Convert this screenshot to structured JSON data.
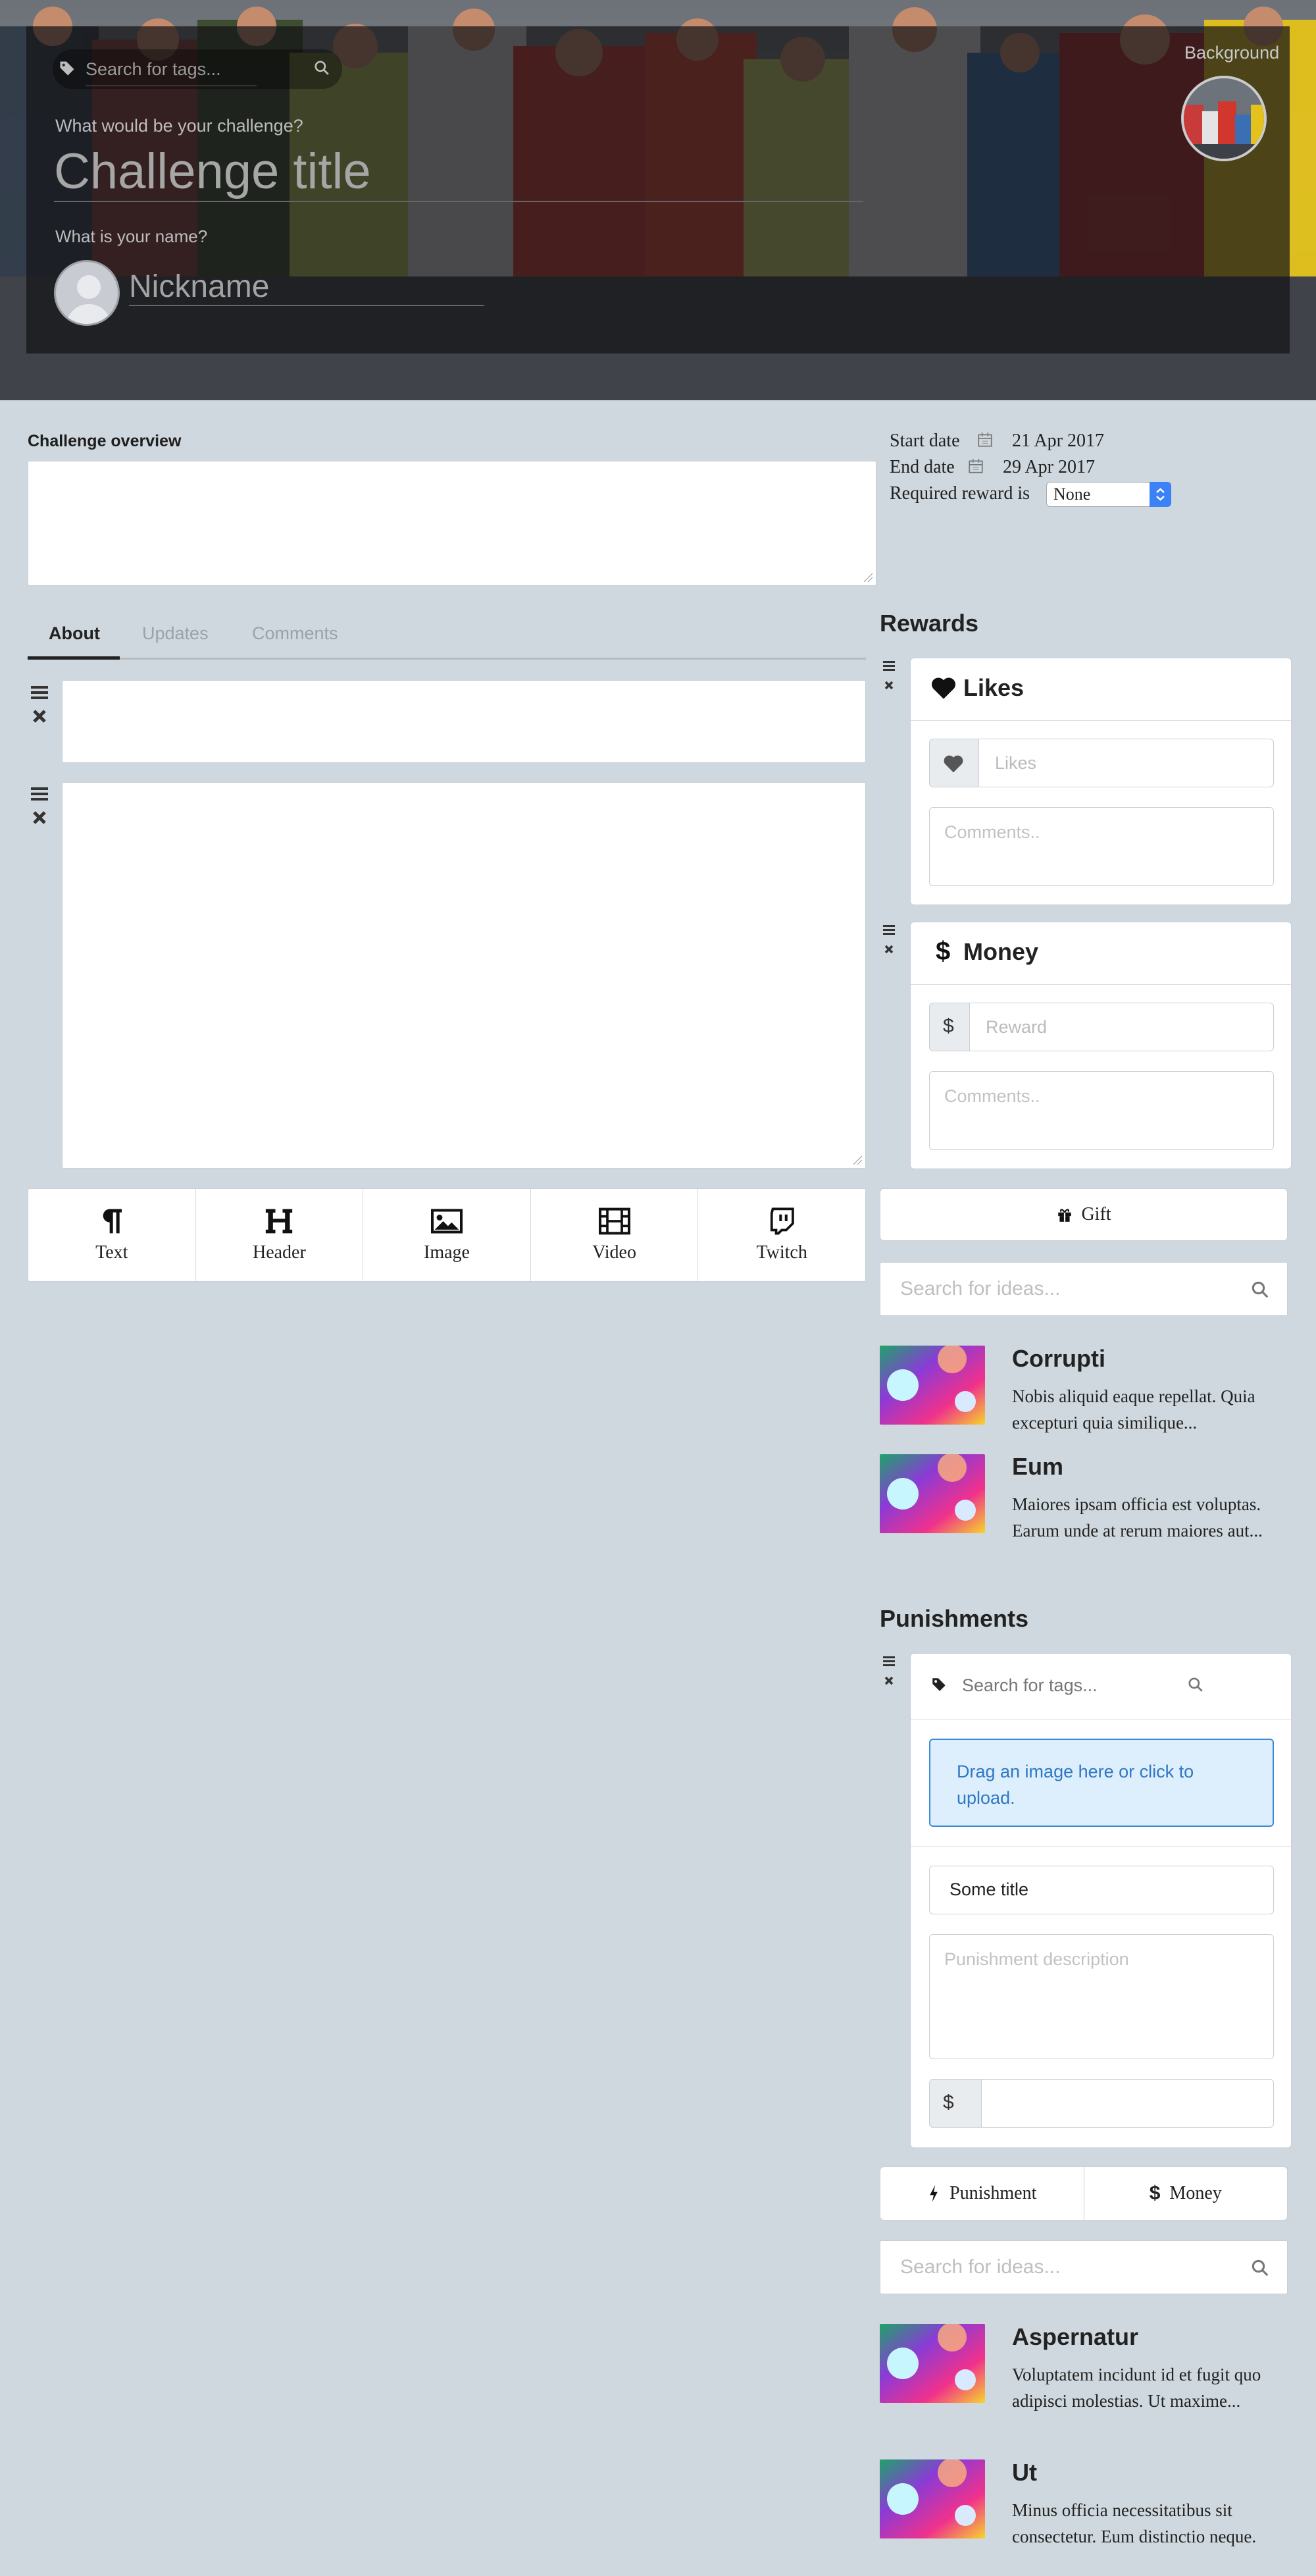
{
  "hero": {
    "tag_search_placeholder": "Search for tags...",
    "challenge_question": "What would be your challenge?",
    "challenge_title_placeholder": "Challenge title",
    "name_question": "What is your name?",
    "nickname_placeholder": "Nickname",
    "background_label": "Background"
  },
  "overview": {
    "label": "Challenge overview",
    "start_label": "Start date",
    "start_value": "21 Apr 2017",
    "end_label": "End date",
    "end_value": "29 Apr 2017",
    "reward_label": "Required reward is",
    "reward_value": "None"
  },
  "tabs": [
    {
      "label": "About"
    },
    {
      "label": "Updates"
    },
    {
      "label": "Comments"
    }
  ],
  "toolbar": [
    {
      "label": "Text",
      "icon": "pilcrow-icon"
    },
    {
      "label": "Header",
      "icon": "header-icon"
    },
    {
      "label": "Image",
      "icon": "image-icon"
    },
    {
      "label": "Video",
      "icon": "film-icon"
    },
    {
      "label": "Twitch",
      "icon": "twitch-icon"
    }
  ],
  "rewards": {
    "heading": "Rewards",
    "likes": {
      "title": "Likes",
      "input_placeholder": "Likes",
      "comments_placeholder": "Comments.."
    },
    "money": {
      "title": "Money",
      "currency": "$",
      "input_placeholder": "Reward",
      "comments_placeholder": "Comments.."
    },
    "gift_label": "Gift",
    "ideas_placeholder": "Search for ideas...",
    "ideas": [
      {
        "title": "Corrupti",
        "desc": "Nobis aliquid eaque repellat. Quia excepturi quia similique..."
      },
      {
        "title": "Eum",
        "desc": "Maiores ipsam officia est voluptas. Earum unde at rerum maiores aut..."
      }
    ]
  },
  "punishments": {
    "heading": "Punishments",
    "tag_search_placeholder": "Search for tags...",
    "upload_text": "Drag an image here or click to upload.",
    "title_value": "Some title",
    "description_placeholder": "Punishment description",
    "currency": "$",
    "punishment_button": "Punishment",
    "money_button": "Money",
    "ideas_placeholder": "Search for ideas...",
    "ideas": [
      {
        "title": "Aspernatur",
        "desc": "Voluptatem incidunt id et fugit quo adipisci molestias. Ut maxime..."
      },
      {
        "title": "Ut",
        "desc": "Minus officia necessitatibus sit consectetur. Eum distinctio neque."
      }
    ]
  },
  "colors": {
    "page_bg": "#cfd8de",
    "upload_bg": "#ddeefc",
    "upload_border": "#3a8ad6",
    "upload_text": "#2f78c4",
    "select_accent": "#3b82f6"
  }
}
